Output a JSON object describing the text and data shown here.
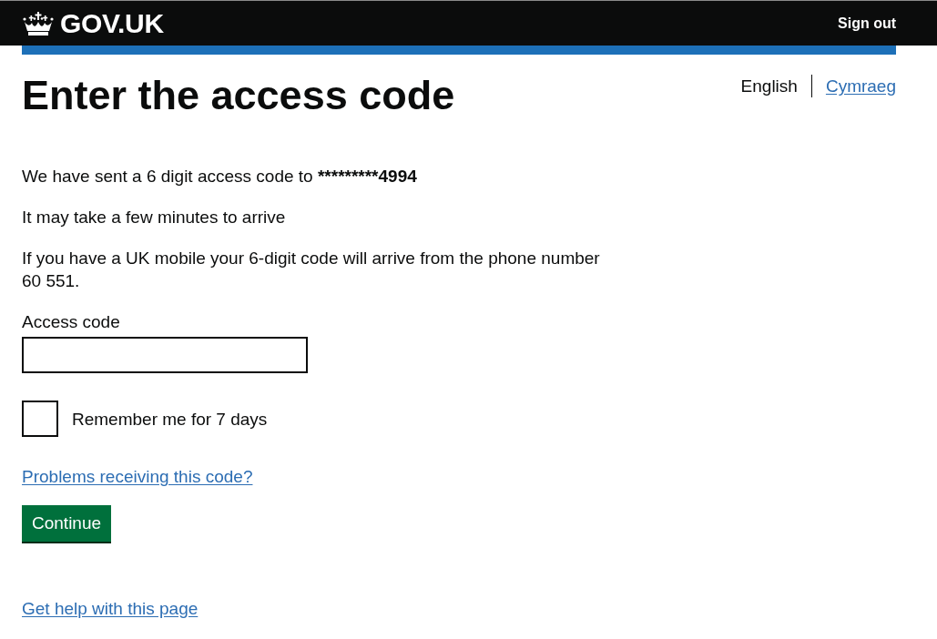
{
  "header": {
    "logo": "GOV.UK",
    "sign_out": "Sign out"
  },
  "language_switcher": [
    {
      "label": "English",
      "selected": true
    },
    {
      "label": "Cymraeg",
      "selected": false
    }
  ],
  "heading": "Enter the access code",
  "paragraphs": [
    {
      "text": "We have sent a 6 digit access code to",
      "emphasis": "*********4994"
    },
    {
      "text": "It may take a few minutes to arrive"
    },
    {
      "text": "If you have a UK mobile your 6-digit code will arrive from the phone number 60 551."
    }
  ],
  "access_code_field": {
    "label": "Access code"
  },
  "remember_checkbox": {
    "label": "Remember me for 7 days",
    "checked": false
  },
  "help_link": "Problems receiving this code?",
  "continue_button": "Continue",
  "footer_link": "Get help with this page"
}
